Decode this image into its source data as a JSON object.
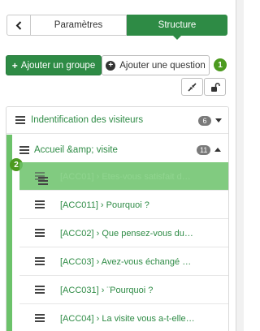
{
  "tabs": {
    "back_icon": "chevron-left-icon",
    "parameters": "Paramètres",
    "structure": "Structure"
  },
  "actions": {
    "add_group": "Ajouter un groupe",
    "add_question": "Ajouter une question",
    "expand_icon": "collapse-arrows-icon",
    "lock_icon": "unlock-icon"
  },
  "steps": [
    "1",
    "2"
  ],
  "groups": [
    {
      "title": "Indentification des visiteurs",
      "count": "6",
      "state": "collapsed"
    },
    {
      "title": "Accueil &amp; visite",
      "count": "11",
      "state": "expanded"
    }
  ],
  "questions": [
    {
      "label": "[ACC01] › Etes-vous satisfait d…",
      "state": "dragging"
    },
    {
      "label": "[ACC011] › Pourquoi ?"
    },
    {
      "label": "[ACC02] › Que pensez-vous du…"
    },
    {
      "label": "[ACC03] › Avez-vous échangé …"
    },
    {
      "label": "[ACC031] › ¨Pourquoi ?"
    },
    {
      "label": "[ACC04] › La visite vous a-t-elle…"
    }
  ],
  "colors": {
    "primary": "#2e8b45",
    "highlight": "#6cc26a",
    "step_badge": "#4c9a1f",
    "count_badge": "#7a7a7a"
  }
}
